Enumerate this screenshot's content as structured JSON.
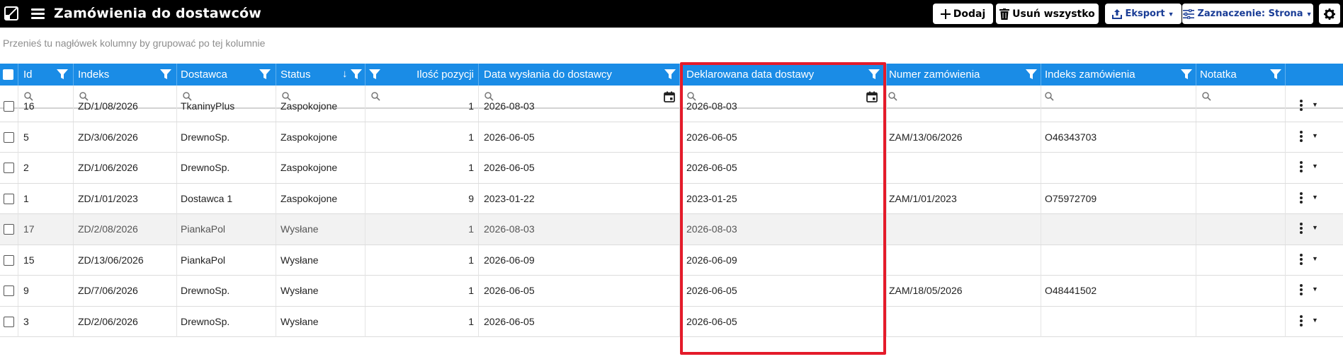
{
  "app": {
    "title": "Zamówienia do dostawców"
  },
  "toolbar": {
    "add_label": "Dodaj",
    "delete_all_label": "Usuń wszystko",
    "export_label": "Eksport",
    "selection_label": "Zaznaczenie: Strona"
  },
  "group_hint": "Przenieś tu nagłówek kolumny by grupować po tej kolumnie",
  "columns": {
    "id": "Id",
    "index": "Indeks",
    "supplier": "Dostawca",
    "status": "Status",
    "items": "Ilość pozycji",
    "sent_date": "Data wysłania do dostawcy",
    "declared_date": "Deklarowana data dostawy",
    "order_number": "Numer zamówienia",
    "order_index": "Indeks zamówienia",
    "note": "Notatka"
  },
  "sort": {
    "column": "Status",
    "direction": "descending"
  },
  "rows": [
    {
      "id": "16",
      "index": "ZD/1/08/2026",
      "supplier": "TkaninyPlus",
      "status": "Zaspokojone",
      "items": "1",
      "sent_date": "2026-08-03",
      "declared_date": "2026-08-03",
      "order_number": "",
      "order_index": "",
      "note": ""
    },
    {
      "id": "5",
      "index": "ZD/3/06/2026",
      "supplier": "DrewnoSp.",
      "status": "Zaspokojone",
      "items": "1",
      "sent_date": "2026-06-05",
      "declared_date": "2026-06-05",
      "order_number": "ZAM/13/06/2026",
      "order_index": "O46343703",
      "note": ""
    },
    {
      "id": "2",
      "index": "ZD/1/06/2026",
      "supplier": "DrewnoSp.",
      "status": "Zaspokojone",
      "items": "1",
      "sent_date": "2026-06-05",
      "declared_date": "2026-06-05",
      "order_number": "",
      "order_index": "",
      "note": ""
    },
    {
      "id": "1",
      "index": "ZD/1/01/2023",
      "supplier": "Dostawca 1",
      "status": "Zaspokojone",
      "items": "9",
      "sent_date": "2023-01-22",
      "declared_date": "2023-01-25",
      "order_number": "ZAM/1/01/2023",
      "order_index": "O75972709",
      "note": ""
    },
    {
      "id": "17",
      "index": "ZD/2/08/2026",
      "supplier": "PiankaPol",
      "status": "Wysłane",
      "items": "1",
      "sent_date": "2026-08-03",
      "declared_date": "2026-08-03",
      "order_number": "",
      "order_index": "",
      "note": ""
    },
    {
      "id": "15",
      "index": "ZD/13/06/2026",
      "supplier": "PiankaPol",
      "status": "Wysłane",
      "items": "1",
      "sent_date": "2026-06-09",
      "declared_date": "2026-06-09",
      "order_number": "",
      "order_index": "",
      "note": ""
    },
    {
      "id": "9",
      "index": "ZD/7/06/2026",
      "supplier": "DrewnoSp.",
      "status": "Wysłane",
      "items": "1",
      "sent_date": "2026-06-05",
      "declared_date": "2026-06-05",
      "order_number": "ZAM/18/05/2026",
      "order_index": "O48441502",
      "note": ""
    },
    {
      "id": "3",
      "index": "ZD/2/06/2026",
      "supplier": "DrewnoSp.",
      "status": "Wysłane",
      "items": "1",
      "sent_date": "2026-06-05",
      "declared_date": "2026-06-05",
      "order_number": "",
      "order_index": "",
      "note": ""
    }
  ],
  "highlighted_column": "Deklarowana data dostawy",
  "colors": {
    "header_bg": "#1a8ce6",
    "topbar_bg": "#000000",
    "highlight_border": "#e41b2a",
    "accent_text": "#1a3d96"
  }
}
